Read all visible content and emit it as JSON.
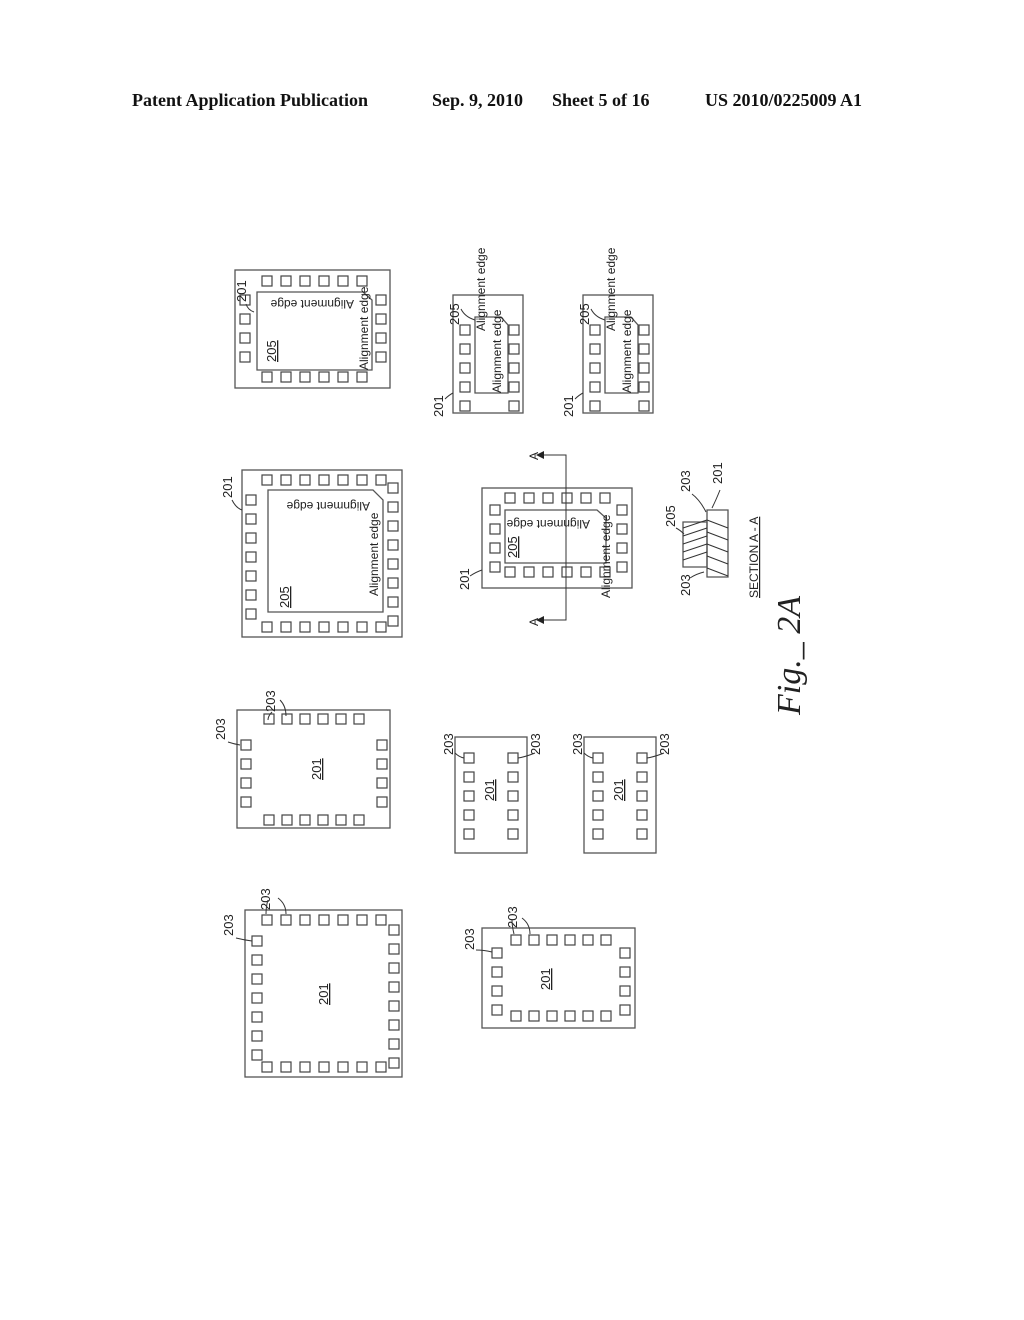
{
  "header": {
    "publication": "Patent Application Publication",
    "date": "Sep. 9, 2010",
    "sheet": "Sheet 5 of 16",
    "number": "US 2010/0225009 A1"
  },
  "labels": {
    "substrate": "201",
    "pad": "203",
    "die": "205",
    "alignment_edge": "Alignment edge",
    "section_marker": "A",
    "section_title": "SECTION A - A",
    "figure": "Fig._ 2A"
  }
}
